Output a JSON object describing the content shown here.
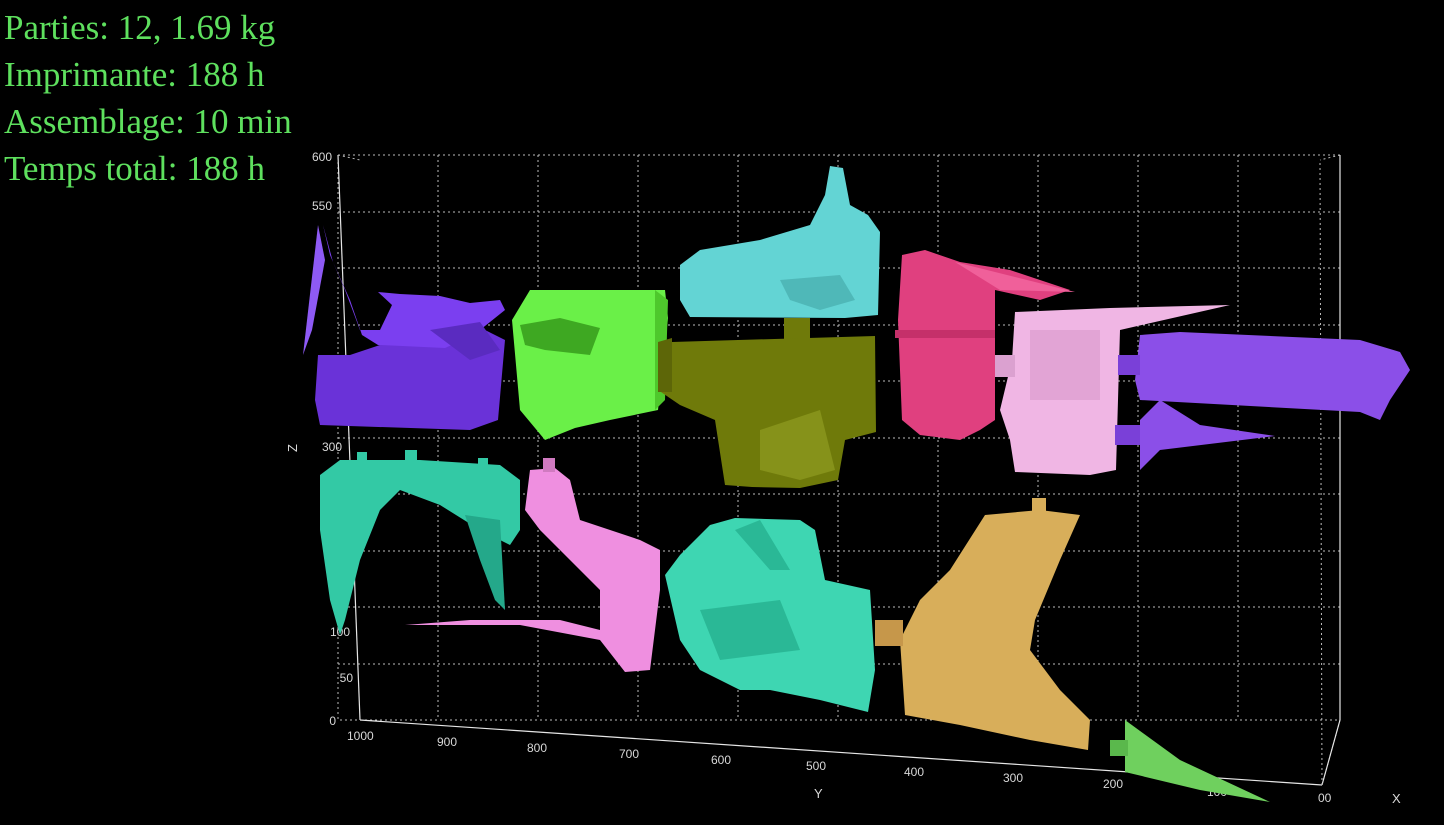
{
  "stats": {
    "parts": "Parties: 12, 1.69 kg",
    "printer": "Imprimante: 188 h",
    "assembly": "Assemblage: 10 min",
    "total_time": "Temps total: 188 h"
  },
  "axes": {
    "x_label": "X",
    "y_label": "Y",
    "z_label": "Z",
    "z_ticks": [
      "0",
      "50",
      "100",
      "300",
      "550",
      "600"
    ],
    "y_ticks": [
      "1000",
      "900",
      "800",
      "700",
      "600",
      "500",
      "400",
      "300",
      "200",
      "100"
    ],
    "x_ticks": [
      "00"
    ]
  },
  "colors": {
    "text": "#5ee05e",
    "background": "#000000",
    "grid": "#bdbdbd",
    "purple": "#7b3ff0",
    "lime": "#5ee83a",
    "cyan": "#63d4d4",
    "olive": "#6f7a0a",
    "magenta": "#e0407f",
    "light_pink": "#f0b6e4",
    "violet": "#8b4fe8",
    "teal": "#33c9a5",
    "pink": "#ef8fe0",
    "turquoise": "#3ed6b2",
    "gold": "#d8ae5a",
    "green_tip": "#6fd05e"
  },
  "parts": [
    {
      "name": "part-purple-grip",
      "color_key": "purple"
    },
    {
      "name": "part-lime-block",
      "color_key": "lime"
    },
    {
      "name": "part-cyan-top",
      "color_key": "cyan"
    },
    {
      "name": "part-olive-body",
      "color_key": "olive"
    },
    {
      "name": "part-magenta-fins",
      "color_key": "magenta"
    },
    {
      "name": "part-lightpink-chamber",
      "color_key": "light_pink"
    },
    {
      "name": "part-violet-barrel",
      "color_key": "violet"
    },
    {
      "name": "part-teal-stock",
      "color_key": "teal"
    },
    {
      "name": "part-pink-handle",
      "color_key": "pink"
    },
    {
      "name": "part-turquoise-receiver",
      "color_key": "turquoise"
    },
    {
      "name": "part-gold-front",
      "color_key": "gold"
    },
    {
      "name": "part-green-tip",
      "color_key": "green_tip"
    }
  ]
}
